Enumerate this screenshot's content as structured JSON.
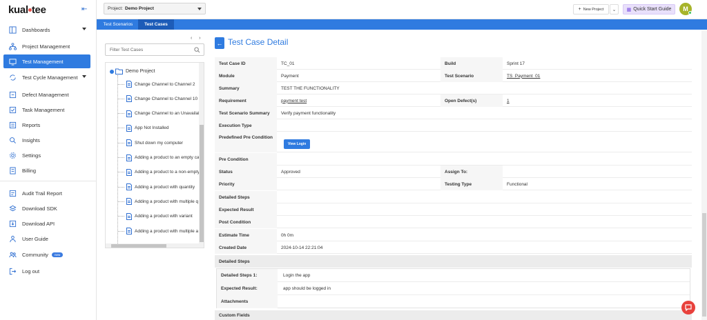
{
  "brand": {
    "logo_text_a": "kual",
    "logo_text_b": "tee"
  },
  "sidebar": {
    "items": [
      {
        "label": "Dashboards"
      },
      {
        "label": "Project Management"
      },
      {
        "label": "Test Management"
      },
      {
        "label": "Test Cycle Management"
      },
      {
        "label": "Defect Management"
      },
      {
        "label": "Task Management"
      },
      {
        "label": "Reports"
      },
      {
        "label": "Insights"
      },
      {
        "label": "Settings"
      },
      {
        "label": "Billing"
      },
      {
        "label": "Audit Trail Report"
      },
      {
        "label": "Download SDK"
      },
      {
        "label": "Download API"
      },
      {
        "label": "User Guide"
      },
      {
        "label": "Community",
        "badge": "new"
      },
      {
        "label": "Log out"
      }
    ]
  },
  "topbar": {
    "project_label": "Project:",
    "project_value": "Demo Project",
    "new_project": "New Project",
    "quick_start": "Quick Start Guide",
    "avatar_initial": "M"
  },
  "tabs": [
    {
      "label": "Test Scenarios"
    },
    {
      "label": "Test Cases"
    }
  ],
  "tree": {
    "filter_placeholder": "Filter Test Cases",
    "pager": "‹ ›",
    "root": "Demo Project",
    "nodes": [
      "Change Channel to Channel 2",
      "Change Channel to Channel 10",
      "Change Channel to an Unavailab",
      "App Not Installed",
      "Shut down my computer",
      "Adding a product to an empty ca",
      "Adding a product to a non-empty",
      "Adding a product with quantity",
      "Adding a product with multiple q",
      "Adding a product with variant",
      "Adding a product with multiple a"
    ]
  },
  "detail": {
    "back": "←",
    "title": "Test Case Detail",
    "labels": {
      "test_case_id": "Test Case ID",
      "build": "Build",
      "module": "Module",
      "test_scenario": "Test Scenario",
      "summary": "Summary",
      "requirement": "Requirement",
      "open_defects": "Open Defect(s)",
      "test_scenario_summary": "Test Scenario Summary",
      "execution_type": "Execution Type",
      "predefined_pre_condition": "Predefined Pre Condition",
      "pre_condition": "Pre Condition",
      "status": "Status",
      "assign_to": "Assign To:",
      "priority": "Priority",
      "testing_type": "Testing Type",
      "detailed_steps": "Detailed Steps",
      "expected_result": "Expected Result",
      "post_condition": "Post Condition",
      "estimate_time": "Estimate Time",
      "created_date": "Created Date"
    },
    "values": {
      "test_case_id": "TC_01",
      "build": "Sprint 17",
      "module": "Payment",
      "test_scenario": "TS_Payment_01",
      "summary": "TEST THE FUNCTIONALITY",
      "requirement": "payment test",
      "open_defects": "1",
      "test_scenario_summary": "Verify payment functionality",
      "view_login": "View Login",
      "status": "Approved",
      "testing_type": "Functional",
      "estimate_time": "0h 0m",
      "created_date": "2024-10-14 22:21:04"
    },
    "steps_section": "Detailed Steps",
    "steps": {
      "step1_label": "Detailed Steps 1:",
      "step1_value": "Login the app",
      "expected_label": "Expected Result:",
      "expected_value": "app should be logged in",
      "attachments_label": "Attachments"
    },
    "custom_fields": "Custom Fields"
  },
  "colors": {
    "accent": "#2f7be0",
    "tab_active": "#1d5cb8",
    "chat": "#e8413c",
    "avatar": "#a7b42a"
  }
}
